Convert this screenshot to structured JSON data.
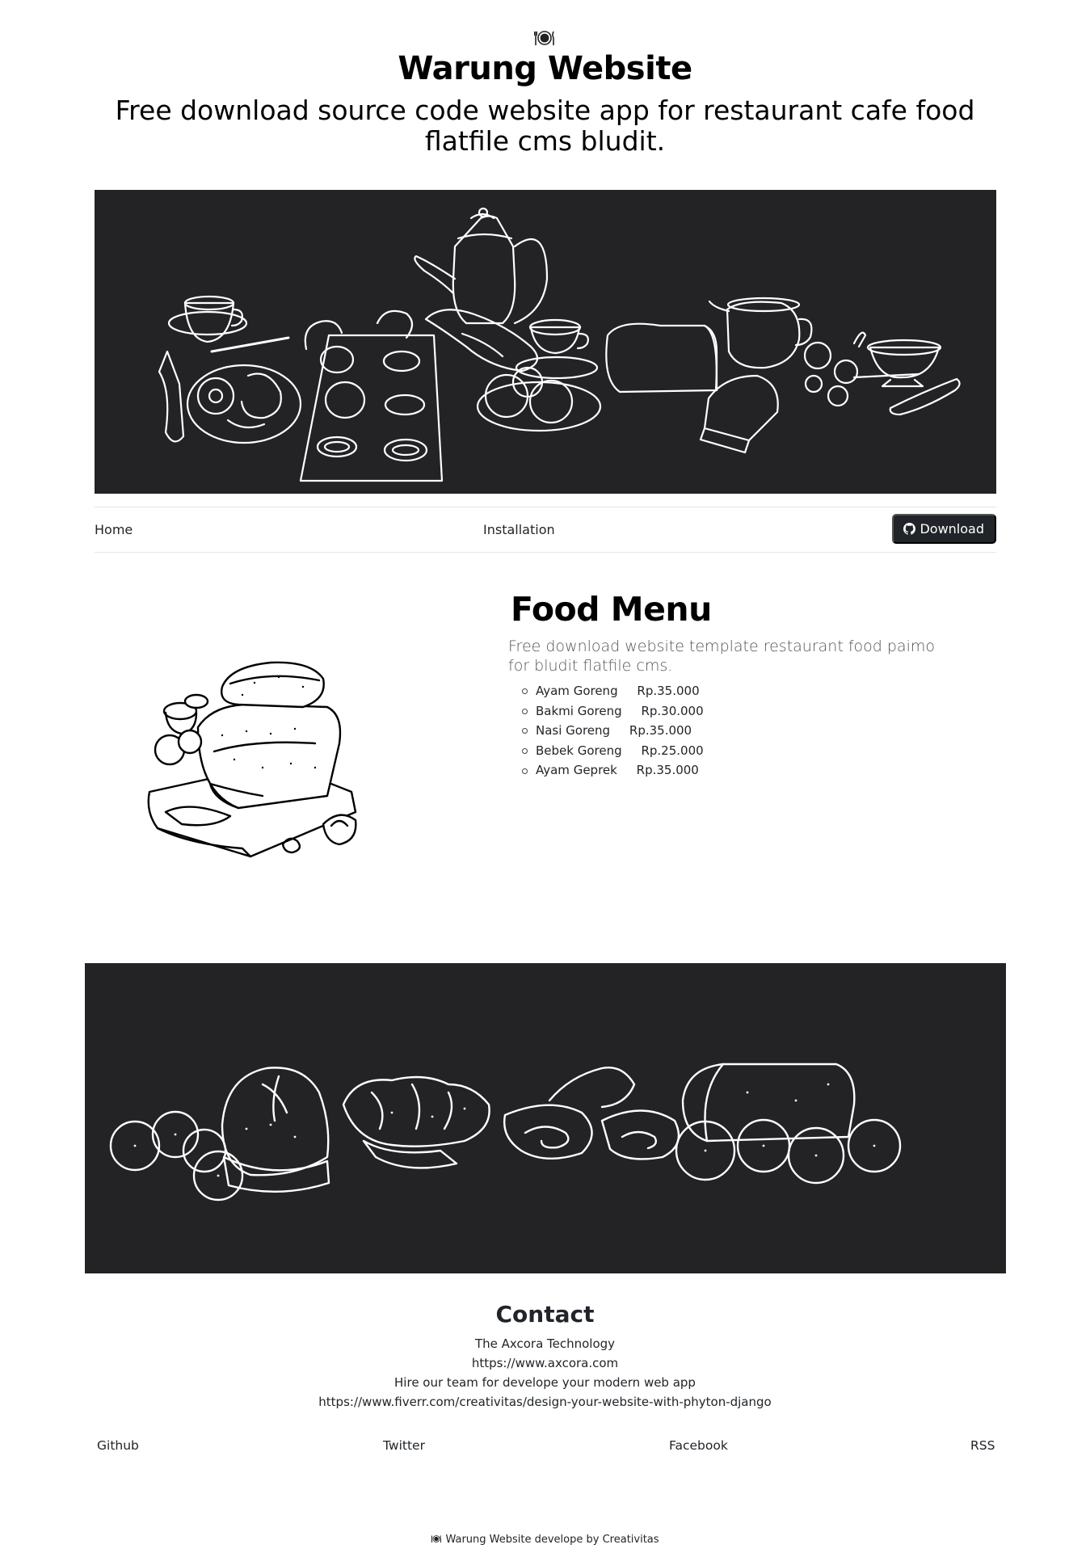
{
  "site": {
    "logo_icon": "plate-cutlery-icon",
    "title": "Warung Website",
    "tagline": "Free download source code website app for restaurant cafe food flatfile cms bludit."
  },
  "hero": {
    "image": "breakfast-table-illustration",
    "background": "#232325"
  },
  "nav": {
    "home": "Home",
    "installation": "Installation",
    "download": "Download",
    "download_icon": "github-icon"
  },
  "menu": {
    "image": "bread-board-illustration",
    "title": "Food Menu",
    "description": "Free download website template restaurant food paimo for bludit flatfile cms.",
    "items": [
      "Ayam Goreng     Rp.35.000",
      "Bakmi Goreng     Rp.30.000",
      "Nasi Goreng     Rp.35.000",
      "Bebek Goreng     Rp.25.000",
      "Ayam Geprek     Rp.35.000"
    ]
  },
  "bread_banner": {
    "image": "bread-assortment-illustration",
    "background": "#232325"
  },
  "contact": {
    "title": "Contact",
    "lines": [
      "The Axcora Technology",
      "https://www.axcora.com",
      "Hire our team for develope your modern web app",
      "https://www.fiverr.com/creativitas/design-your-website-with-phyton-django"
    ]
  },
  "social": {
    "github": "Github",
    "twitter": "Twitter",
    "facebook": "Facebook",
    "rss": "RSS"
  },
  "footer": {
    "site": "Warung Website",
    "middle": " develope by ",
    "author": "Creativitas"
  }
}
